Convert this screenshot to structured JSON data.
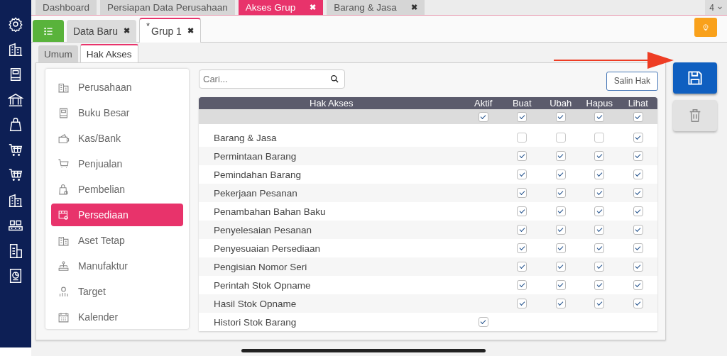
{
  "top_tabs": [
    {
      "label": "Dashboard",
      "selected": false,
      "closable": false
    },
    {
      "label": "Persiapan Data Perusahaan",
      "selected": false,
      "closable": false
    },
    {
      "label": "Akses Grup",
      "selected": true,
      "closable": true
    },
    {
      "label": "Barang & Jasa",
      "selected": false,
      "closable": true
    }
  ],
  "close_glyph": "✖",
  "tab_count": "4",
  "doc_tabs": [
    {
      "label": "Data Baru",
      "selected": false
    },
    {
      "prefix": "*",
      "label": "Grup 1",
      "selected": true
    }
  ],
  "sub_tabs": [
    {
      "label": "Umum",
      "selected": false
    },
    {
      "label": "Hak Akses",
      "selected": true
    }
  ],
  "modules": [
    {
      "label": "Perusahaan",
      "selected": false
    },
    {
      "label": "Buku Besar",
      "selected": false
    },
    {
      "label": "Kas/Bank",
      "selected": false
    },
    {
      "label": "Penjualan",
      "selected": false
    },
    {
      "label": "Pembelian",
      "selected": false
    },
    {
      "label": "Persediaan",
      "selected": true
    },
    {
      "label": "Aset Tetap",
      "selected": false
    },
    {
      "label": "Manufaktur",
      "selected": false
    },
    {
      "label": "Target",
      "selected": false
    },
    {
      "label": "Kalender",
      "selected": false
    }
  ],
  "search": {
    "placeholder": "Cari..."
  },
  "copy_button": "Salin Hak",
  "table": {
    "columns": [
      "Hak Akses",
      "Aktif",
      "Buat",
      "Ubah",
      "Hapus",
      "Lihat"
    ],
    "select_all": [
      true,
      true,
      true,
      true,
      true
    ],
    "rows": [
      {
        "name": "Barang & Jasa",
        "buat": false,
        "ubah": false,
        "hapus": false,
        "lihat": true
      },
      {
        "name": "Permintaan Barang",
        "buat": true,
        "ubah": true,
        "hapus": true,
        "lihat": true
      },
      {
        "name": "Pemindahan Barang",
        "buat": true,
        "ubah": true,
        "hapus": true,
        "lihat": true
      },
      {
        "name": "Pekerjaan Pesanan",
        "buat": true,
        "ubah": true,
        "hapus": true,
        "lihat": true
      },
      {
        "name": "Penambahan Bahan Baku",
        "buat": true,
        "ubah": true,
        "hapus": true,
        "lihat": true
      },
      {
        "name": "Penyelesaian Pesanan",
        "buat": true,
        "ubah": true,
        "hapus": true,
        "lihat": true
      },
      {
        "name": "Penyesuaian Persediaan",
        "buat": true,
        "ubah": true,
        "hapus": true,
        "lihat": true
      },
      {
        "name": "Pengisian Nomor Seri",
        "buat": true,
        "ubah": true,
        "hapus": true,
        "lihat": true
      },
      {
        "name": "Perintah Stok Opname",
        "buat": true,
        "ubah": true,
        "hapus": true,
        "lihat": true
      },
      {
        "name": "Hasil Stok Opname",
        "buat": true,
        "ubah": true,
        "hapus": true,
        "lihat": true
      },
      {
        "name": "Histori Stok Barang",
        "aktif": true
      }
    ]
  }
}
